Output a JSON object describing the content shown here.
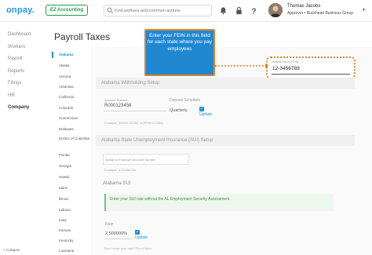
{
  "topbar": {
    "logo": "onpay.",
    "product_badge": "EZ Accounting",
    "search_placeholder": "Find workers and common actions",
    "user_name": "Thomas Jacobs",
    "user_role": "Approver • Buckhead Business Group",
    "icons": [
      "bell-icon",
      "lock-icon",
      "help-icon"
    ]
  },
  "nav": {
    "items": [
      "Dashboard",
      "Workers",
      "Payroll",
      "Reports",
      "Filings",
      "HR",
      "Company"
    ],
    "active": "Company",
    "collapse_label": "« Collapse"
  },
  "page": {
    "title": "Payroll Taxes"
  },
  "states": {
    "items": [
      "Alabama",
      "Alaska",
      "Arizona",
      "Arkansas",
      "California",
      "Colorado",
      "Connecticut",
      "Delaware",
      "District of Columbia",
      "Florida",
      "Georgia",
      "Hawaii",
      "Idaho",
      "Illinois",
      "Indiana",
      "Iowa",
      "Kansas",
      "Kentucky",
      "Louisiana"
    ],
    "active": "Alabama"
  },
  "fein": {
    "label": "Federal Tax Id (FEIN)",
    "value": "12-3456789"
  },
  "callout": {
    "text": "Enter your FEIN in this field for each state where you pay employees"
  },
  "withholding": {
    "header": "Alabama Withholding Setup",
    "account_label": "Account Number",
    "account_value": "R000123456",
    "account_example": "Example: (R000123456) or (R000123456)",
    "schedule_label": "Deposit Schedule",
    "schedule_value": "Quarterly",
    "update_label": "Update"
  },
  "sui": {
    "header": "Alabama State Unemployment Insurance (SUI) Setup",
    "employer_placeholder": "Alabama Employer Account Number",
    "employer_example": "Example: 0123456789",
    "subheader": "Alabama SUI",
    "notice": "Enter your SUI rate without the AL Employment Security Assessment.",
    "rate_label": "Rate",
    "rate_value": "2.500000%",
    "update_label": "Update",
    "footer_link": "Don't know your rate? Find it here"
  }
}
